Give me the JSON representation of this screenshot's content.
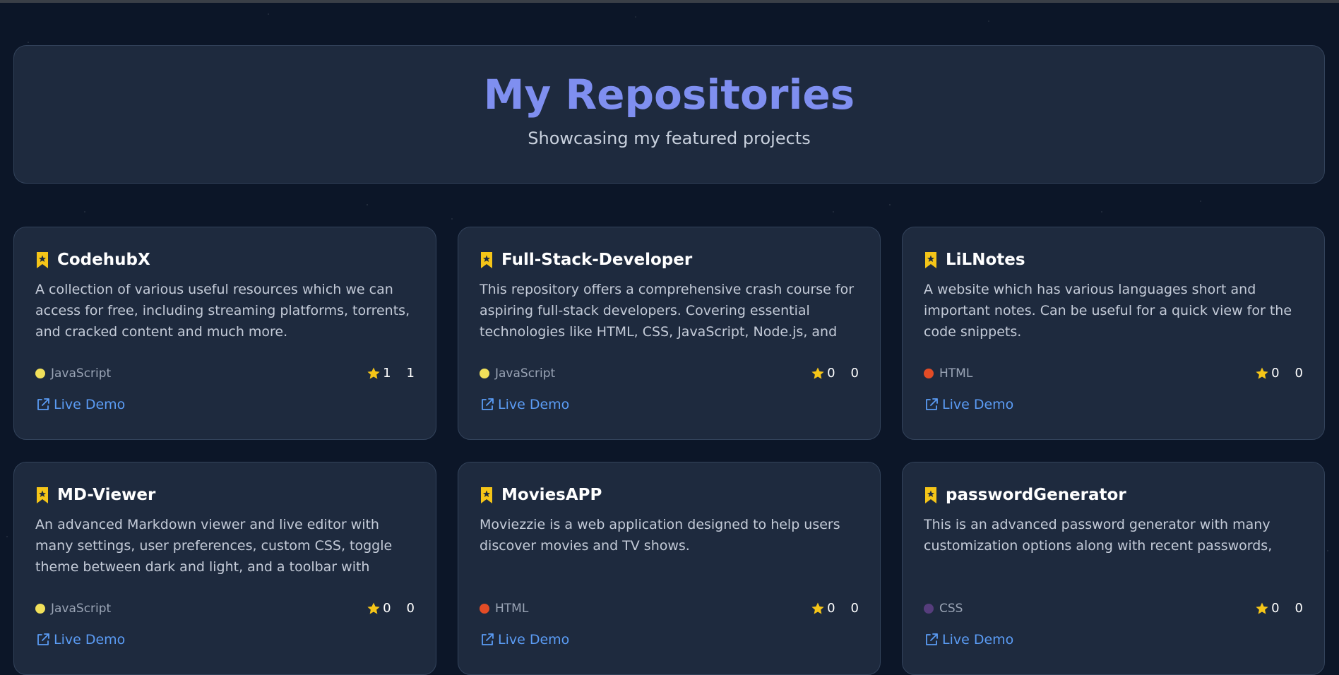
{
  "header": {
    "title": "My Repositories",
    "subtitle": "Showcasing my featured projects"
  },
  "colors": {
    "accent": "#7f8ff0",
    "link": "#5b9cf5",
    "star": "#f5c518",
    "JavaScript": "#f1e05a",
    "HTML": "#e34c26",
    "CSS": "#563d7c"
  },
  "icons": {
    "bookmark": "bookmark-star-icon",
    "star": "star-icon",
    "external": "external-link-icon"
  },
  "repos": [
    {
      "name": "CodehubX",
      "description": "A collection of various useful resources which we can access for free, including streaming platforms, torrents, and cracked content and much more.",
      "language": "JavaScript",
      "stars": "1",
      "forks": "1",
      "demo_label": "Live Demo"
    },
    {
      "name": "Full-Stack-Developer",
      "description": "This repository offers a comprehensive crash course for aspiring full-stack developers. Covering essential technologies like HTML, CSS, JavaScript, Node.js, and",
      "language": "JavaScript",
      "stars": "0",
      "forks": "0",
      "demo_label": "Live Demo"
    },
    {
      "name": "LiLNotes",
      "description": "A website which has various languages short and important notes. Can be useful for a quick view for the code snippets.",
      "language": "HTML",
      "stars": "0",
      "forks": "0",
      "demo_label": "Live Demo"
    },
    {
      "name": "MD-Viewer",
      "description": "An advanced Markdown viewer and live editor with many settings, user preferences, custom CSS, toggle theme between dark and light, and a toolbar with",
      "language": "JavaScript",
      "stars": "0",
      "forks": "0",
      "demo_label": "Live Demo"
    },
    {
      "name": "MoviesAPP",
      "description": "Moviezzie is a web application designed to help users discover movies and TV shows.",
      "language": "HTML",
      "stars": "0",
      "forks": "0",
      "demo_label": "Live Demo"
    },
    {
      "name": "passwordGenerator",
      "description": "This is an advanced password generator with many customization options along with recent passwords,",
      "language": "CSS",
      "stars": "0",
      "forks": "0",
      "demo_label": "Live Demo"
    }
  ]
}
